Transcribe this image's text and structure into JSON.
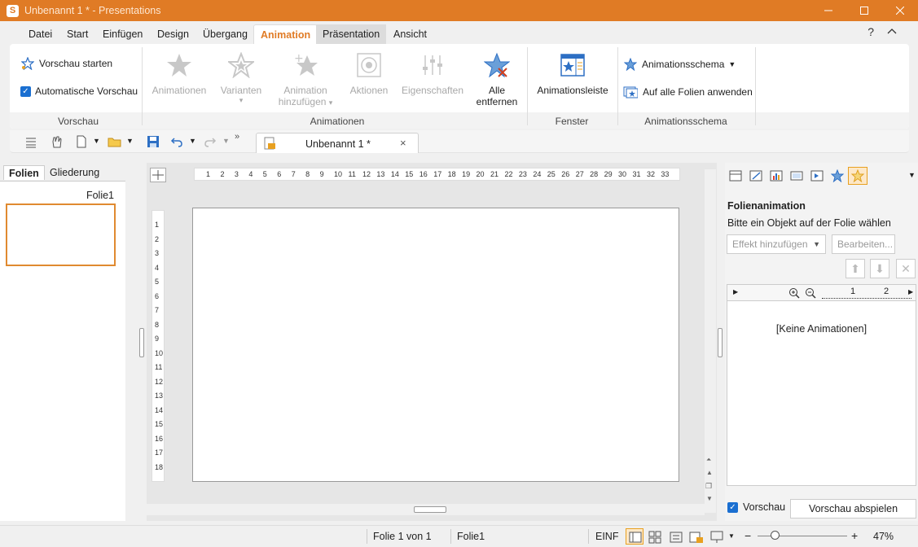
{
  "window": {
    "title": "Unbenannt 1 * - Presentations",
    "app_icon": "S"
  },
  "menu": [
    "Datei",
    "Start",
    "Einfügen",
    "Design",
    "Übergang",
    "Animation",
    "Präsentation",
    "Ansicht"
  ],
  "ribbon": {
    "vorschau_starten": "Vorschau starten",
    "auto_vorschau": "Automatische Vorschau",
    "grp_vorschau": "Vorschau",
    "animationen": "Animationen",
    "varianten": "Varianten",
    "animation": "Animation",
    "hinzufuegen": "hinzufügen",
    "aktionen": "Aktionen",
    "eigenschaften": "Eigenschaften",
    "alle": "Alle",
    "entfernen": "entfernen",
    "grp_animationen": "Animationen",
    "animationsleiste": "Animationsleiste",
    "grp_fenster": "Fenster",
    "animationsschema": "Animationsschema",
    "auf_alle": "Auf alle Folien anwenden",
    "grp_schema": "Animationsschema"
  },
  "doc_tab": {
    "label": "Unbenannt 1 *",
    "close": "×"
  },
  "left_pane": {
    "tab_folien": "Folien",
    "tab_gliederung": "Gliederung",
    "slide_label": "Folie1"
  },
  "hruler": [
    "1",
    "2",
    "3",
    "4",
    "5",
    "6",
    "7",
    "8",
    "9",
    "10",
    "11",
    "12",
    "13",
    "14",
    "15",
    "16",
    "17",
    "18",
    "19",
    "20",
    "21",
    "22",
    "23",
    "24",
    "25",
    "26",
    "27",
    "28",
    "29",
    "30",
    "31",
    "32",
    "33"
  ],
  "vruler": [
    "1",
    "2",
    "3",
    "4",
    "5",
    "6",
    "7",
    "8",
    "9",
    "10",
    "11",
    "12",
    "13",
    "14",
    "15",
    "16",
    "17",
    "18"
  ],
  "right_pane": {
    "title": "Folienanimation",
    "subtitle": "Bitte ein Objekt auf der Folie wählen",
    "effekt": "Effekt hinzufügen",
    "bearbeiten": "Bearbeiten...",
    "timeline_1": "1",
    "timeline_2": "2",
    "no_anim": "[Keine Animationen]",
    "vorschau": "Vorschau",
    "vorschau_abspielen": "Vorschau abspielen"
  },
  "status": {
    "folie": "Folie 1 von 1",
    "name": "Folie1",
    "mode": "EINF",
    "zoom": "47%",
    "minus": "−",
    "plus": "+"
  },
  "colors": {
    "accent": "#e07b25",
    "selection": "#e08a30",
    "check": "#1a6fd1"
  }
}
